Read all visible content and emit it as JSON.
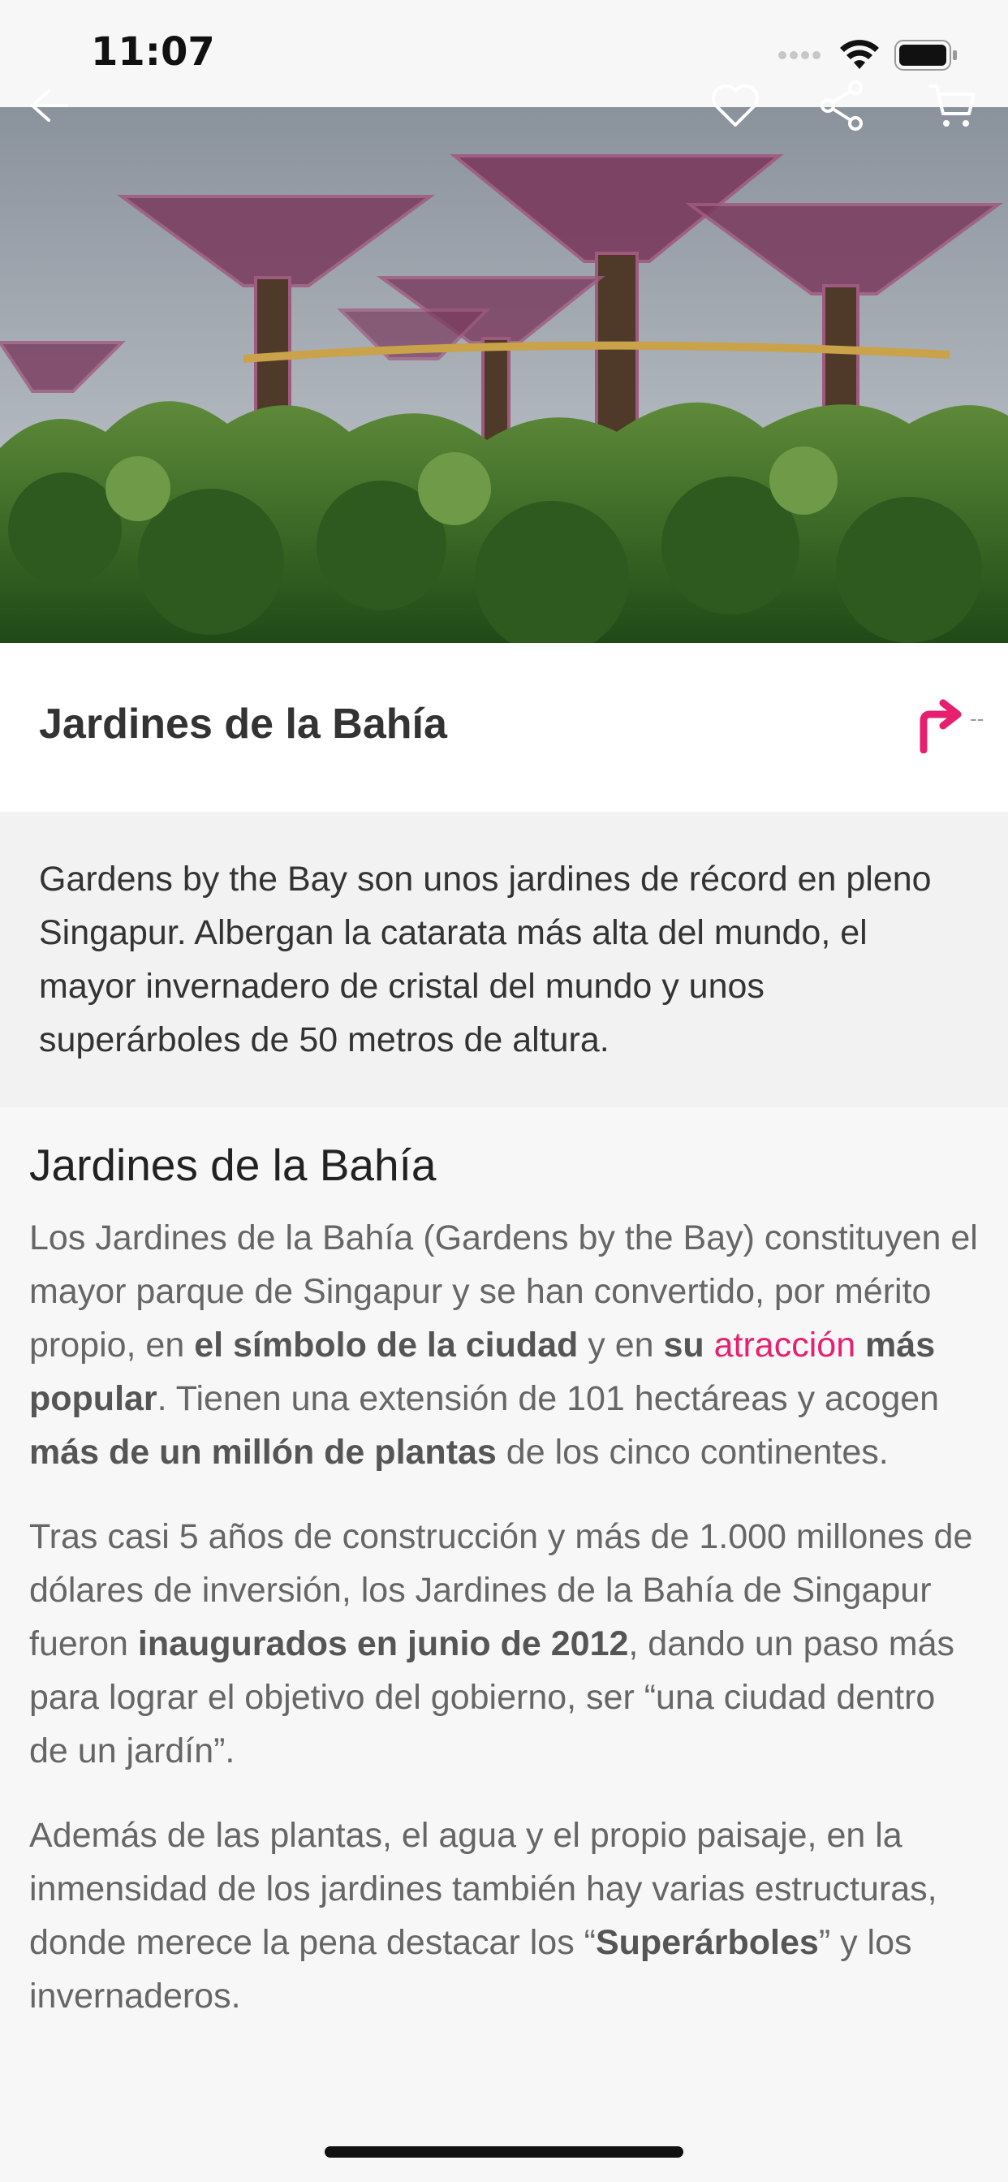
{
  "status_bar": {
    "time": "11:07"
  },
  "hero": {
    "image": "gardens-by-the-bay-supertrees",
    "actions": [
      "back-arrow-icon",
      "heart-icon",
      "share-icon",
      "cart-icon"
    ]
  },
  "title_bar": {
    "title": "Jardines de la Bahía",
    "distance": "--"
  },
  "intro": {
    "text": "Gardens by the Bay son unos jardines de récord en pleno Singapur. Albergan la catarata más alta del mundo, el mayor invernadero de cristal del mundo y unos superárboles de 50 metros de altura."
  },
  "article": {
    "heading": "Jardines de la Bahía",
    "p1": {
      "t1": "Los Jardines de la Bahía (Gardens by the Bay) constituyen el mayor parque de Singapur y se han convertido, por mérito propio, en ",
      "b1": "el símbolo de la ciudad",
      "t2": " y en ",
      "b2": "su ",
      "link": "atracción",
      "b3": " más popular",
      "t3": ". Tienen una extensión de 101 hectáreas y acogen ",
      "b4": "más de un millón de plantas",
      "t4": " de los cinco continentes."
    },
    "p2": {
      "t1": "Tras casi 5 años de construcción y más de 1.000 millones de dólares de inversión, los Jardines de la Bahía de Singapur fueron ",
      "b1": "inaugurados en junio de 2012",
      "t2": ", dando un paso más para lograr el objetivo del gobierno, ser “una ciudad dentro de un jardín”."
    },
    "p3": {
      "t1": "Además de las plantas, el agua y el propio paisaje, en la inmensidad de los jardines también hay varias estructuras, donde merece la pena destacar los “",
      "b1": "Superárboles",
      "t2": "” y los invernaderos."
    }
  },
  "colors": {
    "accent": "#e6206f",
    "background": "#f7f7f7",
    "text": "#666666"
  }
}
